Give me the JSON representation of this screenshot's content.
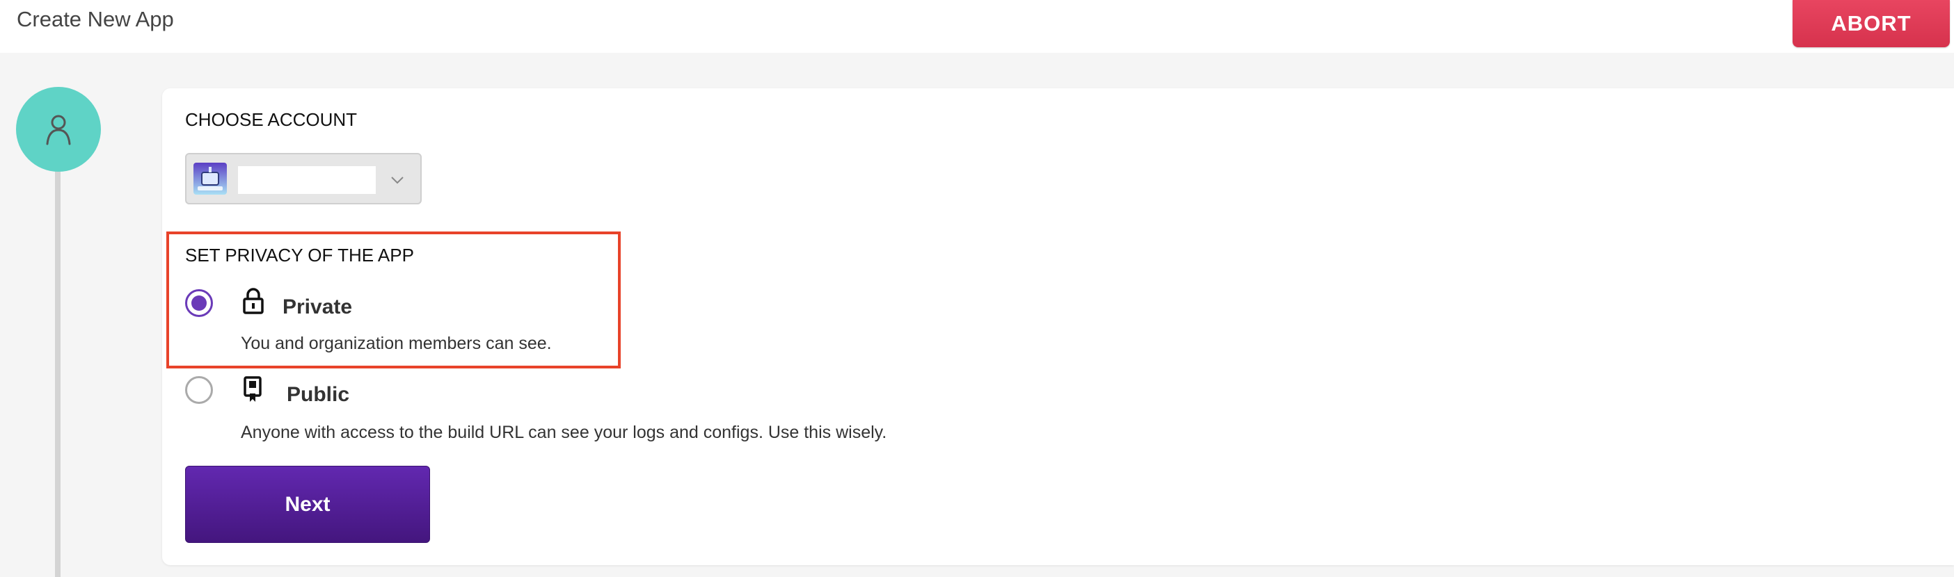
{
  "header": {
    "title": "Create New App",
    "abort_label": "ABORT"
  },
  "stepper": {
    "step_icon": "user-icon",
    "color": "#5fd3c6"
  },
  "account": {
    "section_title": "CHOOSE ACCOUNT",
    "selected_value": "",
    "avatar_icon": "robot-avatar-icon",
    "dropdown_icon": "chevron-down-icon"
  },
  "privacy": {
    "section_title": "SET PRIVACY OF THE APP",
    "options": [
      {
        "label": "Private",
        "description": "You and organization members can see.",
        "icon": "lock-icon",
        "selected": true
      },
      {
        "label": "Public",
        "description": "Anyone with access to the build URL can see your logs and configs. Use this wisely.",
        "icon": "bookmark-icon",
        "selected": false
      }
    ]
  },
  "actions": {
    "next_label": "Next"
  },
  "colors": {
    "accent": "#6a3ab8",
    "abort": "#e03a55",
    "highlight": "#e8432a",
    "next_button": "#52209a"
  }
}
